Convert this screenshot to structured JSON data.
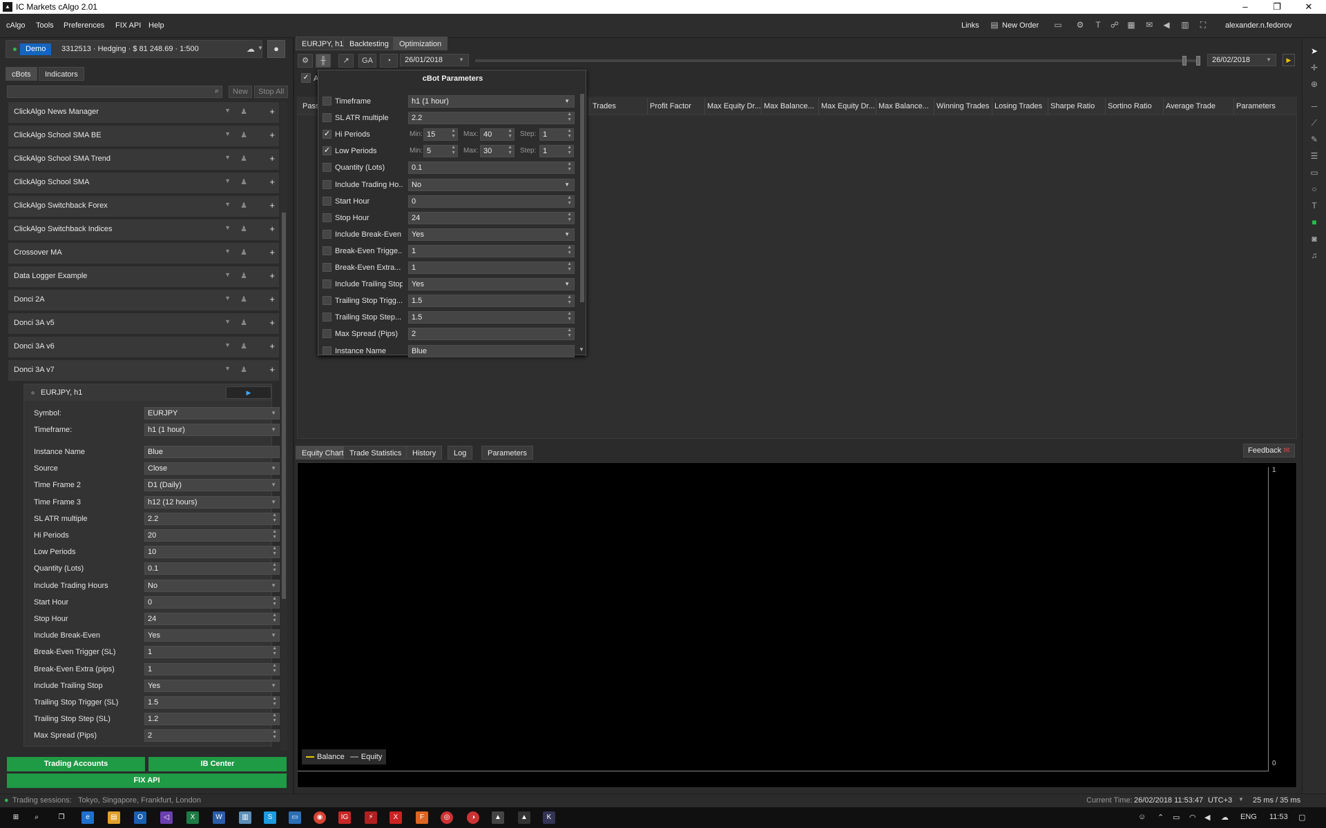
{
  "window": {
    "title": "IC Markets cAlgo 2.01",
    "minimize": "–",
    "restore": "❐",
    "close": "✕"
  },
  "menu": {
    "items": [
      "cAlgo",
      "Tools",
      "Preferences",
      "FIX API",
      "Help"
    ],
    "links": "Links",
    "new_order": "New Order",
    "user": "alexander.n.fedorov"
  },
  "account": {
    "mode": "Demo",
    "info": "3312513 · Hedging · $ 81 248.69 · 1:500"
  },
  "left_tabs": [
    "cBots",
    "Indicators"
  ],
  "bot_search": {
    "placeholder": "",
    "new": "New",
    "stop_all": "Stop All"
  },
  "bots": [
    "ClickAlgo News Manager",
    "ClickAlgo School SMA BE",
    "ClickAlgo School SMA Trend",
    "ClickAlgo School SMA",
    "ClickAlgo Switchback Forex",
    "ClickAlgo Switchback Indices",
    "Crossover MA",
    "Data Logger Example",
    "Donci 2A",
    "Donci 3A v5",
    "Donci 3A v6",
    "Donci 3A v7"
  ],
  "instance": {
    "title": "EURJPY, h1",
    "symbol_label": "Symbol:",
    "symbol": "EURJPY",
    "timeframe_label": "Timeframe:",
    "timeframe": "h1 (1 hour)",
    "params": [
      {
        "label": "Instance Name",
        "value": "Blue",
        "kind": "text"
      },
      {
        "label": "Source",
        "value": "Close",
        "kind": "dropdown"
      },
      {
        "label": "Time Frame 2",
        "value": "D1 (Daily)",
        "kind": "dropdown"
      },
      {
        "label": "Time Frame 3",
        "value": "h12 (12 hours)",
        "kind": "dropdown"
      },
      {
        "label": "SL ATR multiple",
        "value": "2.2",
        "kind": "spin"
      },
      {
        "label": "Hi Periods",
        "value": "20",
        "kind": "spin"
      },
      {
        "label": "Low Periods",
        "value": "10",
        "kind": "spin"
      },
      {
        "label": "Quantity (Lots)",
        "value": "0.1",
        "kind": "spin"
      },
      {
        "label": "Include Trading Hours",
        "value": "No",
        "kind": "dropdown"
      },
      {
        "label": "Start Hour",
        "value": "0",
        "kind": "spin"
      },
      {
        "label": "Stop Hour",
        "value": "24",
        "kind": "spin"
      },
      {
        "label": "Include Break-Even",
        "value": "Yes",
        "kind": "dropdown"
      },
      {
        "label": "Break-Even Trigger (SL)",
        "value": "1",
        "kind": "spin"
      },
      {
        "label": "Break-Even Extra (pips)",
        "value": "1",
        "kind": "spin"
      },
      {
        "label": "Include Trailing Stop",
        "value": "Yes",
        "kind": "dropdown"
      },
      {
        "label": "Trailing Stop Trigger (SL)",
        "value": "1.5",
        "kind": "spin"
      },
      {
        "label": "Trailing Stop Step (SL)",
        "value": "1.2",
        "kind": "spin"
      },
      {
        "label": "Max Spread (Pips)",
        "value": "2",
        "kind": "spin"
      }
    ]
  },
  "bottom_buttons": {
    "trading_accounts": "Trading Accounts",
    "ib_center": "IB Center",
    "fix_api": "FIX API"
  },
  "status": {
    "sessions_label": "Trading sessions:",
    "sessions": "Tokyo, Singapore, Frankfurt, London",
    "current_time_label": "Current Time:",
    "current_time": "26/02/2018 11:53:47",
    "tz": "UTC+3",
    "latency": "25 ms / 35 ms"
  },
  "right_tabs": [
    "EURJPY, h1",
    "Backtesting",
    "Optimization"
  ],
  "toolbar": {
    "start_date": "26/01/2018",
    "end_date": "26/02/2018",
    "ga": "GA"
  },
  "optimization": {
    "checkbox_label": "A",
    "columns": [
      "Pass",
      "Trades",
      "Profit Factor",
      "Max Equity Dr...",
      "Max Balance...",
      "Max Equity Dr...",
      "Max Balance...",
      "Winning Trades",
      "Losing Trades",
      "Sharpe Ratio",
      "Sortino Ratio",
      "Average Trade",
      "Parameters"
    ]
  },
  "cbot_params": {
    "title": "cBot Parameters",
    "min": "Min:",
    "max": "Max:",
    "step": "Step:",
    "rows": [
      {
        "label": "Timeframe",
        "value": "h1 (1 hour)",
        "checked": false,
        "kind": "dropdown"
      },
      {
        "label": "SL ATR multiple",
        "value": "2.2",
        "checked": false,
        "kind": "spin"
      },
      {
        "label": "Hi Periods",
        "checked": true,
        "kind": "range",
        "min": "15",
        "max": "40",
        "step": "1"
      },
      {
        "label": "Low Periods",
        "checked": true,
        "kind": "range",
        "min": "5",
        "max": "30",
        "step": "1"
      },
      {
        "label": "Quantity (Lots)",
        "value": "0.1",
        "checked": false,
        "kind": "spin"
      },
      {
        "label": "Include Trading Ho...",
        "value": "No",
        "checked": false,
        "kind": "dropdown"
      },
      {
        "label": "Start Hour",
        "value": "0",
        "checked": false,
        "kind": "spin"
      },
      {
        "label": "Stop Hour",
        "value": "24",
        "checked": false,
        "kind": "spin"
      },
      {
        "label": "Include Break-Even",
        "value": "Yes",
        "checked": false,
        "kind": "dropdown"
      },
      {
        "label": "Break-Even Trigge...",
        "value": "1",
        "checked": false,
        "kind": "spin"
      },
      {
        "label": "Break-Even Extra...",
        "value": "1",
        "checked": false,
        "kind": "spin"
      },
      {
        "label": "Include Trailing Stop",
        "value": "Yes",
        "checked": false,
        "kind": "dropdown"
      },
      {
        "label": "Trailing Stop Trigg...",
        "value": "1.5",
        "checked": false,
        "kind": "spin"
      },
      {
        "label": "Trailing Stop Step...",
        "value": "1.5",
        "checked": false,
        "kind": "spin"
      },
      {
        "label": "Max Spread (Pips)",
        "value": "2",
        "checked": false,
        "kind": "spin"
      },
      {
        "label": "Instance Name",
        "value": "Blue",
        "checked": false,
        "kind": "text"
      }
    ]
  },
  "bottom_tabs": [
    "Equity Chart",
    "Trade Statistics",
    "History",
    "Log",
    "Parameters"
  ],
  "feedback": "Feedback",
  "equity_chart": {
    "axis_top": "1",
    "axis_bottom": "0",
    "legend_balance": "Balance",
    "legend_equity": "Equity"
  },
  "taskbar": {
    "lang": "ENG",
    "time": "11:53"
  }
}
